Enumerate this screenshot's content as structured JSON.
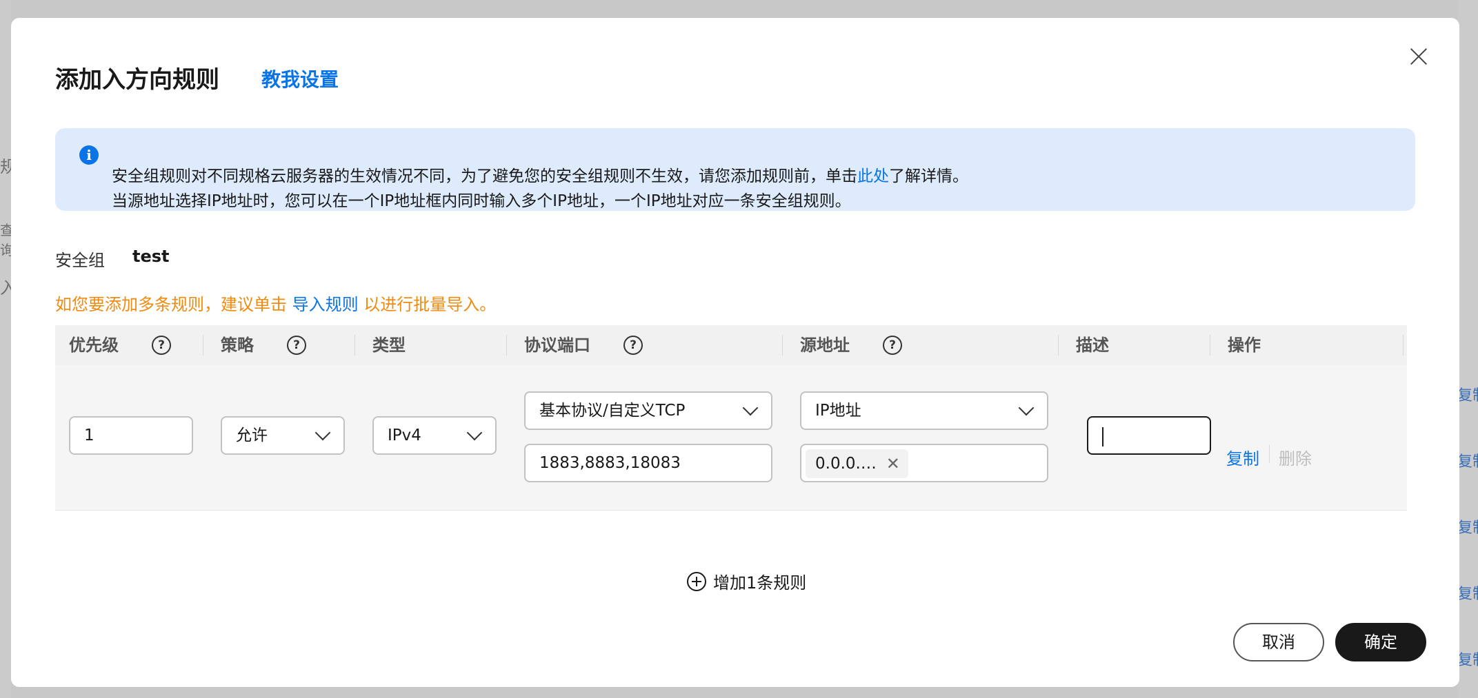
{
  "background": {
    "left_fragments": [
      "规",
      "查询",
      "入"
    ],
    "right_links": [
      "复制",
      "复制",
      "复制",
      "复制",
      "复制"
    ]
  },
  "dialog": {
    "title": "添加入方向规则",
    "teach_link": "教我设置",
    "notice": {
      "line1_prefix": "安全组规则对不同规格云服务器的生效情况不同，为了避免您的安全组规则不生效，请您添加规则前，单击",
      "line1_link": "此处",
      "line1_suffix": "了解详情。",
      "line2": "当源地址选择IP地址时，您可以在一个IP地址框内同时输入多个IP地址，一个IP地址对应一条安全组规则。"
    },
    "security_group": {
      "label": "安全组",
      "value": "test"
    },
    "hint": {
      "prefix": "如您要添加多条规则，建议单击 ",
      "link": "导入规则",
      "suffix": " 以进行批量导入。"
    },
    "table": {
      "headers": {
        "priority": "优先级",
        "policy": "策略",
        "type": "类型",
        "protocol_port": "协议端口",
        "source": "源地址",
        "description": "描述",
        "action": "操作"
      },
      "row": {
        "priority": "1",
        "policy": "允许",
        "type": "IPv4",
        "protocol": "基本协议/自定义TCP",
        "ports": "1883,8883,18083",
        "source_type": "IP地址",
        "source_tag": "0.0.0.…",
        "description": "",
        "copy": "复制",
        "delete": "删除"
      }
    },
    "add_rule": "增加1条规则",
    "buttons": {
      "cancel": "取消",
      "ok": "确定"
    }
  }
}
